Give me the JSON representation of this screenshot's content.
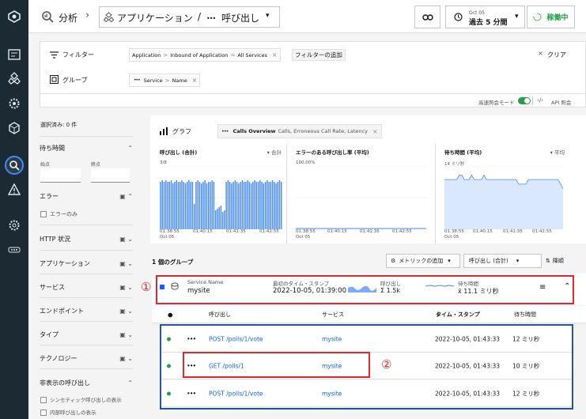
{
  "header": {
    "breadcrumb_root": "分析",
    "breadcrumb_mid": "アプリケーション",
    "breadcrumb_sep": "/",
    "breadcrumb_current": "呼び出し",
    "time_top": "Oct 05",
    "time_main": "過去 5 分間",
    "status": "稼働中"
  },
  "filters": {
    "filter_label": "フィルター",
    "group_label": "グループ",
    "filter_tags": [
      "Application",
      "Inbound of Application",
      "All Services"
    ],
    "filter_sep1": ">",
    "filter_sep2": "=",
    "add_filter": "フィルターの追加",
    "clear": "クリア",
    "group_tag_1": "Service",
    "group_tag_2": "Name",
    "group_sep": ">",
    "advanced": "高速照会モード",
    "api": "API 照会"
  },
  "left": {
    "selected": "選択済み: 0 件",
    "latency": "待ち時間",
    "min": "始点",
    "max": "終点",
    "error": "エラー",
    "error_only": "エラーのみ",
    "http": "HTTP 状況",
    "app": "アプリケーション",
    "service": "サービス",
    "endpoint": "エンドポイント",
    "type": "タイプ",
    "tech": "テクノロジー",
    "hidden": "非表示の呼び出し",
    "synthetic": "シンセティック呼び出しの表示",
    "internal": "内部呼び出しの表示"
  },
  "graph": {
    "label": "グラフ",
    "tag_title": "Calls Overview",
    "tag_rest": "Calls, Erroneous Call Rate, Latency"
  },
  "charts": [
    {
      "title": "呼び出し (合計)",
      "agg": "合計",
      "ymax": "3/8",
      "x": [
        "01:38:55",
        "01:40:15",
        "01:41:35",
        "01:42:55"
      ],
      "xsub": "Oct 05"
    },
    {
      "title": "エラーのある呼び出し率 (平均)",
      "agg": "",
      "ymax": "100.00%",
      "x": [
        "01:38:55",
        "01:40:15",
        "01:41:35",
        "01:42:55"
      ],
      "xsub": "Oct 05"
    },
    {
      "title": "待ち時間 (平均)",
      "agg": "平均",
      "ymax": "14 ミリ秒",
      "x": [
        "01:38:55",
        "01:40:15",
        "01:41:35",
        "01:42:55"
      ],
      "xsub": "Oct 05"
    }
  ],
  "chart_data": [
    {
      "type": "bar",
      "title": "呼び出し (合計)",
      "values": [
        30,
        31,
        30,
        31,
        30,
        30,
        31,
        29,
        30,
        31,
        30,
        30,
        31,
        30,
        29,
        30,
        31,
        30,
        30,
        16,
        30,
        31,
        30,
        29,
        30,
        31,
        29,
        30,
        30,
        31,
        30,
        12,
        13,
        14,
        15,
        11,
        12,
        30,
        31,
        30,
        29,
        30,
        31,
        30,
        29,
        30,
        31,
        30,
        30,
        31,
        30,
        29,
        30,
        31,
        30,
        30,
        31,
        30,
        29,
        30,
        31,
        30,
        30,
        31,
        30,
        29,
        30,
        31,
        30
      ]
    },
    {
      "type": "line",
      "title": "エラーのある呼び出し率 (平均)",
      "values": [
        0,
        0,
        0,
        0,
        0,
        0,
        0,
        0,
        0,
        0,
        0,
        0,
        0,
        0,
        0,
        0,
        0,
        0,
        0,
        0
      ]
    },
    {
      "type": "area",
      "title": "待ち時間 (平均)",
      "values": [
        11,
        11,
        11,
        11,
        11,
        11,
        12,
        12,
        11,
        11,
        11,
        12,
        11,
        11,
        11,
        11,
        12,
        11,
        11,
        11,
        11,
        11,
        11,
        11,
        11,
        11,
        11,
        11,
        11,
        11,
        10,
        10,
        10,
        10,
        11,
        11,
        11,
        11,
        11,
        11,
        11,
        11,
        11,
        11,
        11,
        11,
        11,
        10,
        9
      ]
    }
  ],
  "groups": {
    "count": "1 個のグループ",
    "metric_btn": "メトリックの追加",
    "sort_by": "呼び出し (合計)",
    "sort_dir": "降順"
  },
  "group_row": {
    "name_label": "Service.Name",
    "name": "mysite",
    "time_label": "最初のタイム・スタンプ",
    "time": "2022-10-05, 01:39:00",
    "calls_label": "呼び出し",
    "calls": "Σ 1.5k",
    "lat_label": "待ち時間",
    "lat": "x̄ 11.1 ミリ秒"
  },
  "table": {
    "headers": [
      "呼び出し",
      "サービス",
      "タイム・スタンプ",
      "待ち時間"
    ],
    "rows": [
      {
        "call": "POST /polls/1/vote",
        "service": "mysite",
        "time": "2022-10-05, 01:43:33",
        "latency": "12 ミリ秒"
      },
      {
        "call": "GET /polls/1",
        "service": "mysite",
        "time": "2022-10-05, 01:43:33",
        "latency": "10 ミリ秒"
      },
      {
        "call": "POST /polls/1/vote",
        "service": "mysite",
        "time": "2022-10-05, 01:43:33",
        "latency": "12 ミリ秒"
      }
    ]
  },
  "annot": {
    "one": "①",
    "two": "②"
  },
  "colors": {
    "bar": "#4589ff",
    "status": "#24a148",
    "red": "#e8252b",
    "blue": "#2454a6"
  }
}
